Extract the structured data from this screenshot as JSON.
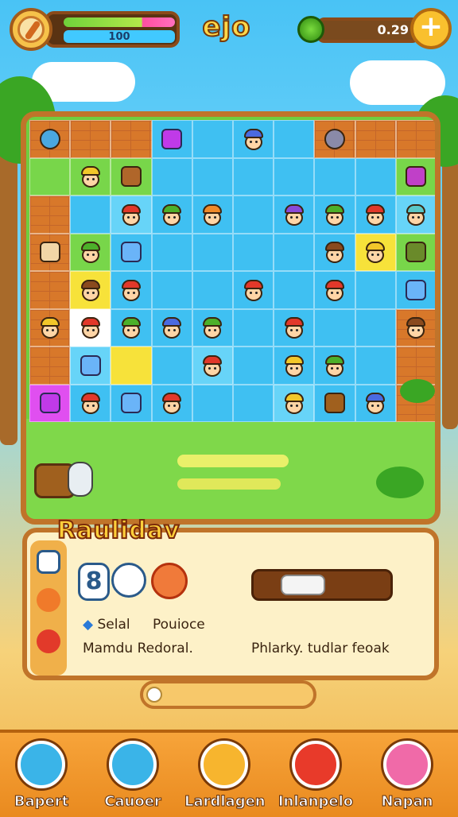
{
  "hud": {
    "health_value": "100",
    "title": "ejo",
    "coins": "0.29",
    "add_label": "+"
  },
  "board": {
    "rows": [
      [
        "c-w:orb",
        "c-w",
        "c-w",
        "c-b:gem-purple",
        "c-b",
        "c-b:tok-blue",
        "c-b",
        "c-w:stone",
        "c-w",
        "c-w"
      ],
      [
        "c-g",
        "c-g:tok-yellow",
        "c-g:hut",
        "c-b",
        "c-b",
        "c-b",
        "c-b",
        "c-b",
        "c-b",
        "c-g:octo"
      ],
      [
        "c-w",
        "c-b",
        "c-lb:tok-red",
        "c-b:tok-green",
        "c-b:tok-orange",
        "c-b",
        "c-b:tok-purple",
        "c-b:tok-green",
        "c-b:tok-red",
        "c-lb:tok-teal"
      ],
      [
        "c-w:star",
        "c-g:tok-green",
        "c-b:gem-blue",
        "c-b",
        "c-b",
        "c-b",
        "c-b",
        "c-b:tok-brown",
        "c-y:tok-yellow",
        "c-g:leaf"
      ],
      [
        "c-w",
        "c-y:tok-brown",
        "c-b:tok-red",
        "c-b",
        "c-b",
        "c-b:tok-red",
        "c-b",
        "c-b:tok-red",
        "c-b",
        "c-b:gem-blue"
      ],
      [
        "c-w:tok-yellow",
        "c-wh:tok-red",
        "c-b:tok-green",
        "c-b:tok-blue",
        "c-b:tok-green",
        "c-b",
        "c-b:tok-red",
        "c-b",
        "c-b",
        "c-w:tok-brown"
      ],
      [
        "c-w",
        "c-lb:gem-blue",
        "c-y",
        "c-b",
        "c-lb:tok-red",
        "c-b",
        "c-b:tok-yellow",
        "c-b:tok-green",
        "c-b",
        "c-w"
      ],
      [
        "c-p:gem-purple",
        "c-b:tok-red",
        "c-b:gem-blue",
        "c-b:tok-red",
        "c-b",
        "c-b",
        "c-lb:tok-yellow",
        "c-b:barrel",
        "c-b:tok-blue",
        "c-w"
      ]
    ]
  },
  "panel": {
    "banner": "Raulidav",
    "slot_1": "8",
    "label_a": "Selal",
    "label_b": "Pouioce",
    "label_c": "Mamdu Redoral.",
    "label_d": "Phlarky. tudlar feoak",
    "progress": 0.05
  },
  "nav": [
    {
      "label": "Bapert",
      "color": "#3ab4e8",
      "icon": "map-icon"
    },
    {
      "label": "Cauoer",
      "color": "#3ab4e8",
      "icon": "chat-icon"
    },
    {
      "label": "Lardlagen",
      "color": "#f7b52e",
      "icon": "cookie-icon"
    },
    {
      "label": "Inlanpelo",
      "color": "#e83a2a",
      "icon": "star-icon"
    },
    {
      "label": "Napan",
      "color": "#f06aa8",
      "icon": "fruit-icon"
    }
  ]
}
